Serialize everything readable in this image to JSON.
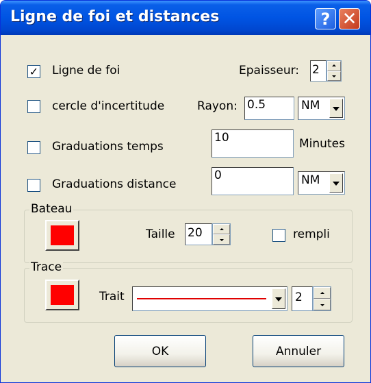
{
  "window": {
    "title": "Ligne de foi et distances",
    "help_glyph": "?",
    "close_glyph": "✕"
  },
  "rows": {
    "ligne_de_foi": {
      "label": "Ligne de foi",
      "checked": true,
      "check_glyph": "✓"
    },
    "epaisseur": {
      "label": "Epaisseur:",
      "value": "2"
    },
    "cercle": {
      "label": "cercle d'incertitude",
      "checked": false
    },
    "rayon": {
      "label": "Rayon:",
      "value": "0.5",
      "unit": "NM"
    },
    "graduations_temps": {
      "label": "Graduations temps",
      "checked": false,
      "value": "10",
      "unit_label": "Minutes"
    },
    "graduations_distance": {
      "label": "Graduations distance",
      "checked": false,
      "value": "0",
      "unit": "NM"
    }
  },
  "bateau": {
    "legend": "Bateau",
    "color": "#FF0000",
    "taille_label": "Taille",
    "taille_value": "20",
    "rempli_label": "rempli",
    "rempli_checked": false
  },
  "trace": {
    "legend": "Trace",
    "color": "#FF0000",
    "trait_label": "Trait",
    "line_color": "#E00000",
    "width_value": "2"
  },
  "buttons": {
    "ok": "OK",
    "cancel": "Annuler"
  },
  "colors": {
    "titlebar": "#0054E3",
    "dialog_bg": "#ECE9D8",
    "swatch": "#FF0000"
  }
}
